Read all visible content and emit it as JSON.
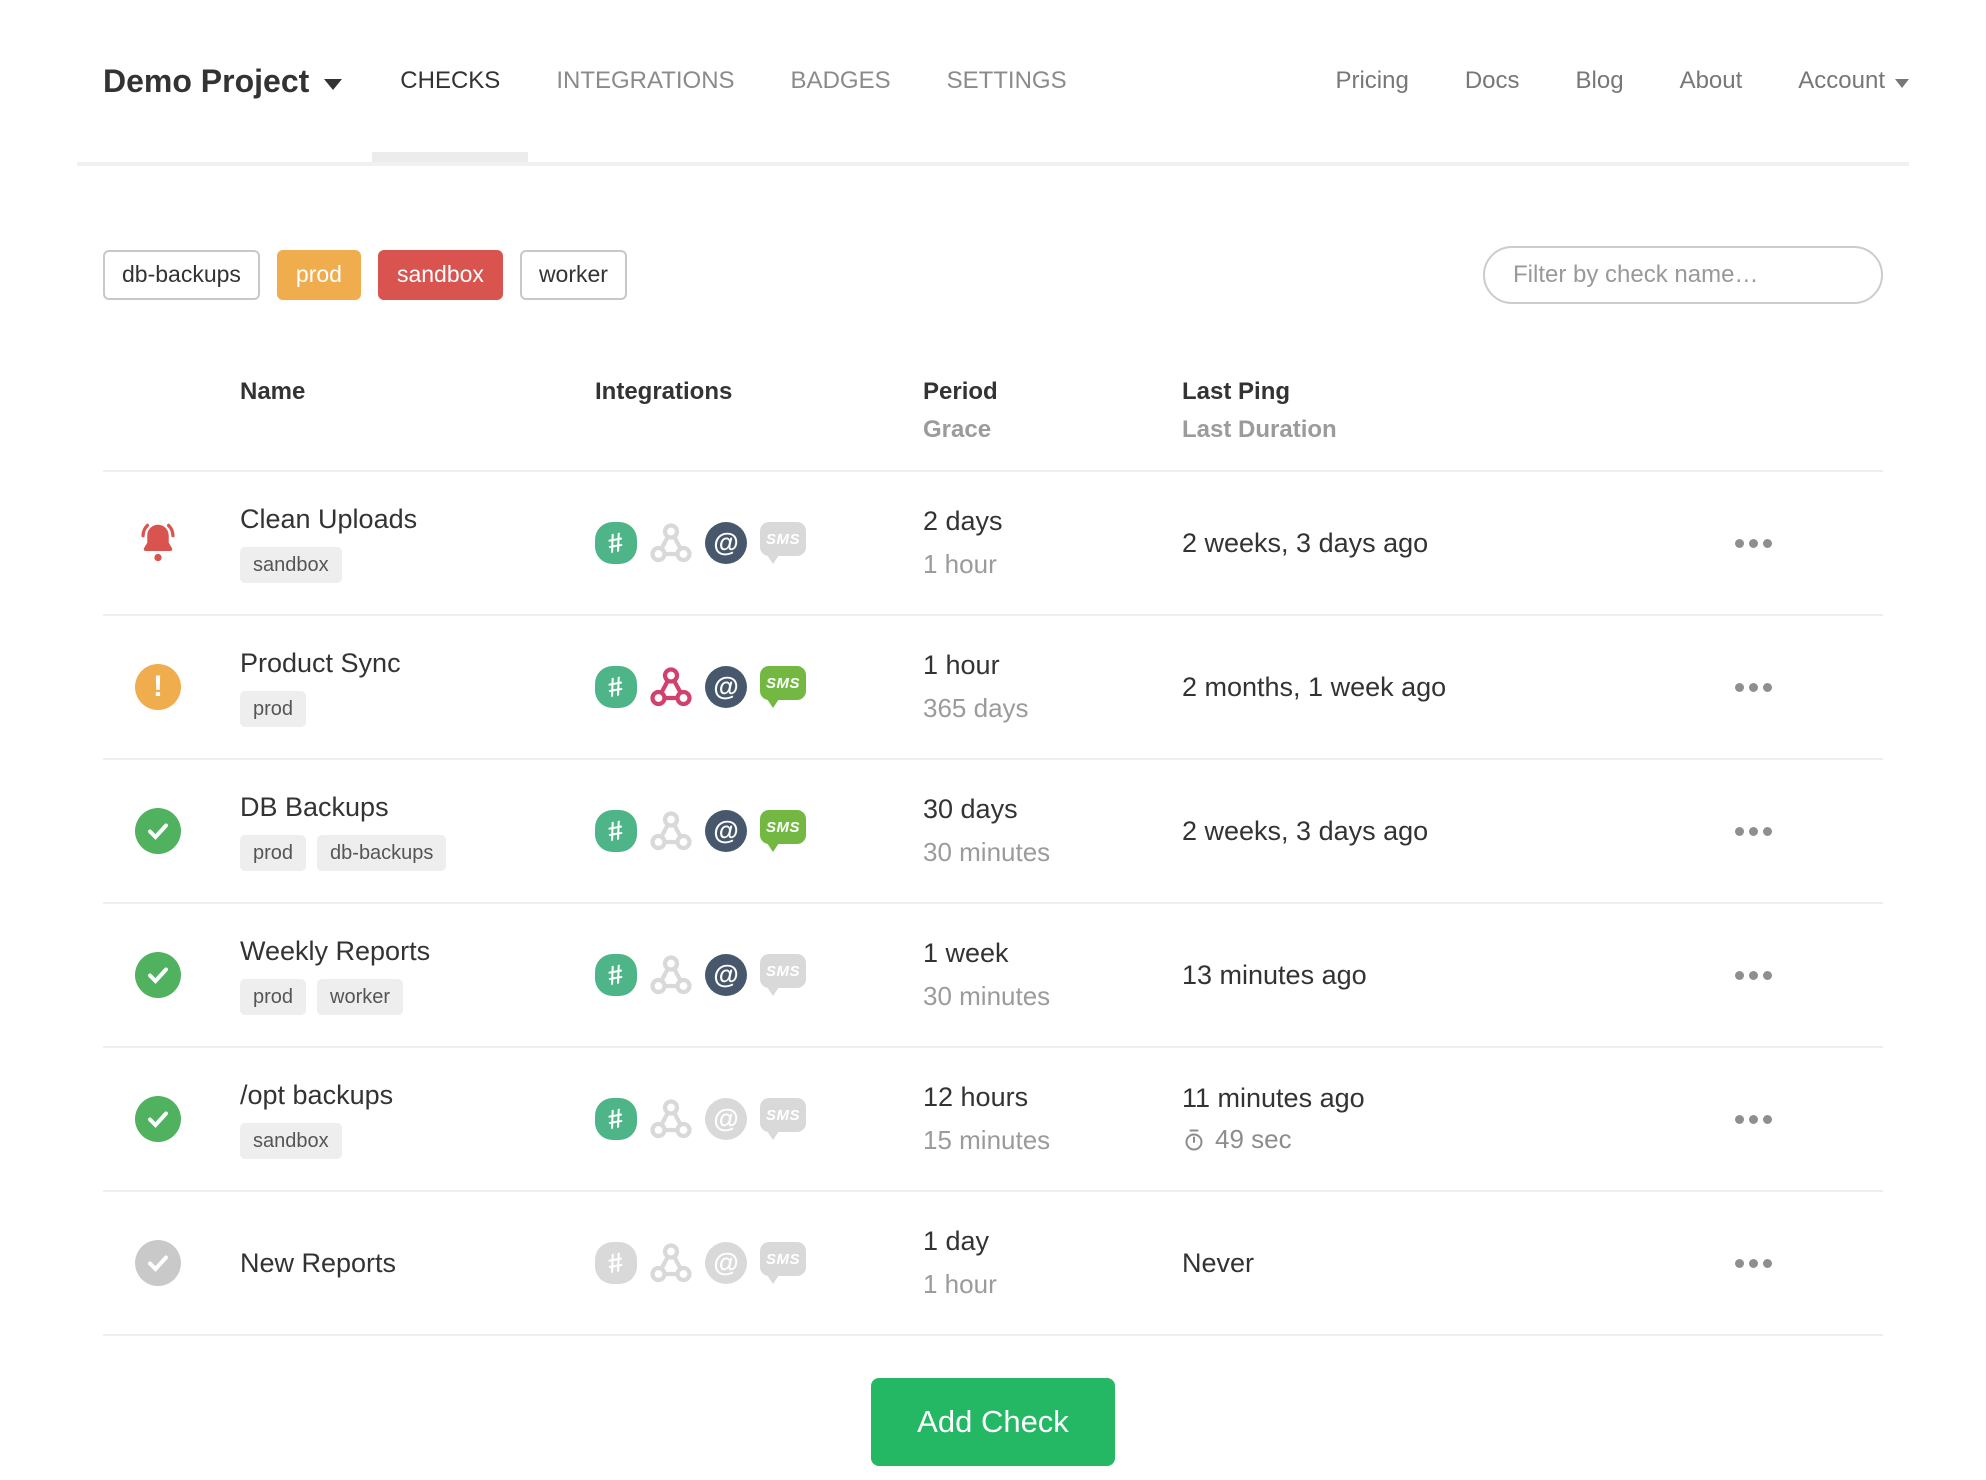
{
  "nav": {
    "project": "Demo Project",
    "tabs": [
      {
        "label": "CHECKS",
        "active": true
      },
      {
        "label": "INTEGRATIONS",
        "active": false
      },
      {
        "label": "BADGES",
        "active": false
      },
      {
        "label": "SETTINGS",
        "active": false
      }
    ],
    "links": [
      "Pricing",
      "Docs",
      "Blog",
      "About"
    ],
    "account_label": "Account"
  },
  "filters": {
    "tags": [
      {
        "label": "db-backups",
        "style": "default"
      },
      {
        "label": "prod",
        "style": "orange"
      },
      {
        "label": "sandbox",
        "style": "red"
      },
      {
        "label": "worker",
        "style": "default"
      }
    ],
    "search_placeholder": "Filter by check name…"
  },
  "table": {
    "headers": {
      "name": "Name",
      "integrations": "Integrations",
      "period": "Period",
      "grace": "Grace",
      "last_ping": "Last Ping",
      "last_duration": "Last Duration"
    },
    "rows": [
      {
        "status": "alert",
        "name": "Clean Uploads",
        "tags": [
          "sandbox"
        ],
        "integrations": [
          {
            "type": "slack",
            "enabled": true
          },
          {
            "type": "webhook",
            "enabled": false
          },
          {
            "type": "email",
            "enabled": true
          },
          {
            "type": "sms",
            "enabled": false
          }
        ],
        "period": "2 days",
        "grace": "1 hour",
        "last_ping": "2 weeks, 3 days ago",
        "last_duration": null
      },
      {
        "status": "late",
        "name": "Product Sync",
        "tags": [
          "prod"
        ],
        "integrations": [
          {
            "type": "slack",
            "enabled": true
          },
          {
            "type": "webhook",
            "enabled": true
          },
          {
            "type": "email",
            "enabled": true
          },
          {
            "type": "sms",
            "enabled": true
          }
        ],
        "period": "1 hour",
        "grace": "365 days",
        "last_ping": "2 months, 1 week ago",
        "last_duration": null
      },
      {
        "status": "up",
        "name": "DB Backups",
        "tags": [
          "prod",
          "db-backups"
        ],
        "integrations": [
          {
            "type": "slack",
            "enabled": true
          },
          {
            "type": "webhook",
            "enabled": false
          },
          {
            "type": "email",
            "enabled": true
          },
          {
            "type": "sms",
            "enabled": true
          }
        ],
        "period": "30 days",
        "grace": "30 minutes",
        "last_ping": "2 weeks, 3 days ago",
        "last_duration": null
      },
      {
        "status": "up",
        "name": "Weekly Reports",
        "tags": [
          "prod",
          "worker"
        ],
        "integrations": [
          {
            "type": "slack",
            "enabled": true
          },
          {
            "type": "webhook",
            "enabled": false
          },
          {
            "type": "email",
            "enabled": true
          },
          {
            "type": "sms",
            "enabled": false
          }
        ],
        "period": "1 week",
        "grace": "30 minutes",
        "last_ping": "13 minutes ago",
        "last_duration": null
      },
      {
        "status": "up",
        "name": "/opt backups",
        "tags": [
          "sandbox"
        ],
        "integrations": [
          {
            "type": "slack",
            "enabled": true
          },
          {
            "type": "webhook",
            "enabled": false
          },
          {
            "type": "email",
            "enabled": false
          },
          {
            "type": "sms",
            "enabled": false
          }
        ],
        "period": "12 hours",
        "grace": "15 minutes",
        "last_ping": "11 minutes ago",
        "last_duration": "49 sec"
      },
      {
        "status": "new",
        "name": "New Reports",
        "tags": [],
        "integrations": [
          {
            "type": "slack",
            "enabled": false
          },
          {
            "type": "webhook",
            "enabled": false
          },
          {
            "type": "email",
            "enabled": false
          },
          {
            "type": "sms",
            "enabled": false
          }
        ],
        "period": "1 day",
        "grace": "1 hour",
        "last_ping": "Never",
        "last_duration": null
      }
    ]
  },
  "icons": {
    "slack_glyph": "#",
    "email_glyph": "@",
    "sms_label": "SMS"
  },
  "add_check_label": "Add Check",
  "colors": {
    "status_alert_red": "#d9534f",
    "status_late_orange": "#f0ad4e",
    "status_up_green": "#50b15e",
    "status_new_gray": "#c9c9c9",
    "tag_orange": "#f0ad4e",
    "tag_red": "#d9534f",
    "slack_green": "#4eb588",
    "webhook_pink": "#d2416e",
    "email_navy": "#47586d",
    "sms_green": "#73b843",
    "disabled_gray": "#d9d9d9",
    "add_check_green": "#24b764"
  }
}
